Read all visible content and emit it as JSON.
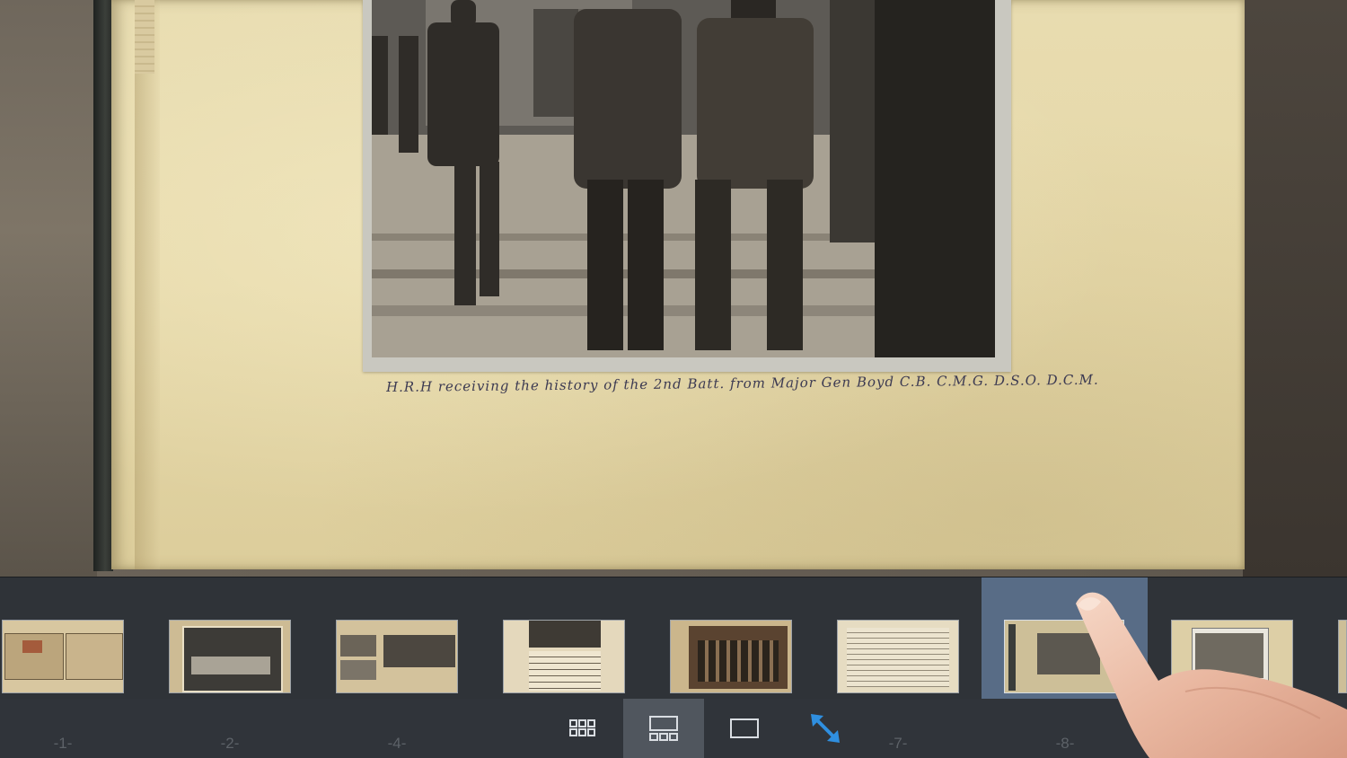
{
  "album": {
    "caption": "H.R.H receiving the history of the 2nd Batt. from Major Gen Boyd C.B. C.M.G. D.S.O. D.C.M."
  },
  "thumbnails": [
    {
      "page": "-1-",
      "style": "spread-light",
      "selected": false
    },
    {
      "page": "-2-",
      "style": "group-photo",
      "selected": false
    },
    {
      "page": "-4-",
      "style": "spread-two-photos",
      "selected": false
    },
    {
      "page": "",
      "style": "parade-note",
      "selected": false
    },
    {
      "page": "",
      "style": "sepia-group",
      "selected": false
    },
    {
      "page": "-7-",
      "style": "typed-letter",
      "selected": false
    },
    {
      "page": "-8-",
      "style": "officers-photo",
      "selected": true
    },
    {
      "page": "",
      "style": "field-photo",
      "selected": false
    }
  ],
  "view_modes": [
    {
      "name": "grid-view",
      "icon": "grid-icon",
      "active": false
    },
    {
      "name": "filmstrip-view",
      "icon": "filmstrip-icon",
      "active": true
    },
    {
      "name": "single-page-view",
      "icon": "single-page-icon",
      "active": false
    },
    {
      "name": "fullscreen",
      "icon": "expand-arrows-icon",
      "active": false
    }
  ],
  "colors": {
    "strip_bg": "#2f3338",
    "selected_thumb_bg": "#586c86",
    "fullscreen_icon": "#2f8fe0",
    "active_view_bg": "#50565e"
  }
}
